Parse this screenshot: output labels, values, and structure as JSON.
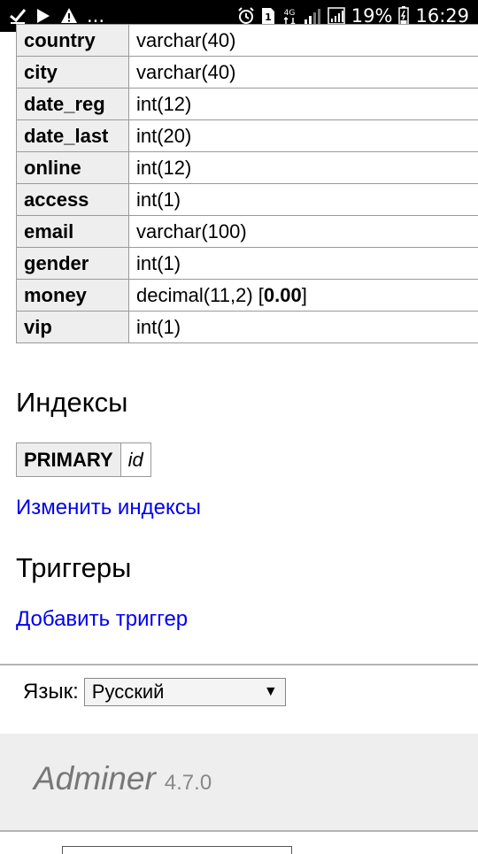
{
  "status_bar": {
    "left_icons": [
      "check-icon",
      "play-icon",
      "warning-icon",
      "more-icon"
    ],
    "more": "...",
    "right_icons": [
      "alarm-icon",
      "sim-1-icon",
      "4g-icon",
      "signal-icon",
      "signal-icon",
      "battery-icon"
    ],
    "network": "4G",
    "battery_percent": "19%",
    "time": "16:29"
  },
  "fields": [
    {
      "name": "country",
      "type": "varchar(40)"
    },
    {
      "name": "city",
      "type": "varchar(40)"
    },
    {
      "name": "date_reg",
      "type": "int(12)"
    },
    {
      "name": "date_last",
      "type": "int(20)"
    },
    {
      "name": "online",
      "type": "int(12)"
    },
    {
      "name": "access",
      "type": "int(1)"
    },
    {
      "name": "email",
      "type": "varchar(100)"
    },
    {
      "name": "gender",
      "type": "int(1)"
    },
    {
      "name": "money",
      "type": "decimal(11,2)",
      "default_prefix": " [",
      "default": "0.00",
      "default_suffix": "]"
    },
    {
      "name": "vip",
      "type": "int(1)"
    }
  ],
  "indexes": {
    "heading": "Индексы",
    "rows": [
      {
        "type": "PRIMARY",
        "column": "id"
      }
    ],
    "edit_link": "Изменить индексы"
  },
  "triggers": {
    "heading": "Триггеры",
    "add_link": "Добавить триггер"
  },
  "language": {
    "label": "Язык:",
    "selected": "Русский"
  },
  "footer": {
    "brand": "Adminer",
    "version": "4.7.0"
  },
  "colors": {
    "link": "#0000ee",
    "header_cell_bg": "#eeeeee",
    "footer_bg": "#eeeeee"
  }
}
